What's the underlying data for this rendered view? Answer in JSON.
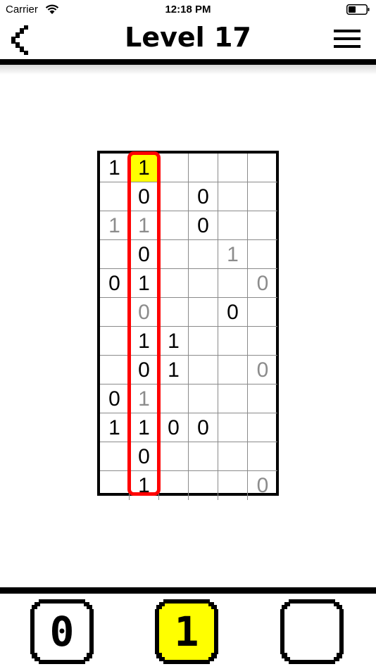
{
  "status_bar": {
    "carrier": "Carrier",
    "time": "12:18 PM"
  },
  "header": {
    "title": "Level 17",
    "back_icon": "back-chevron-icon",
    "menu_icon": "hamburger-menu-icon"
  },
  "colors": {
    "highlight_border": "#ff0000",
    "selected_cell": "#ffff00",
    "given_digit": "#000000",
    "entered_digit": "#8c8c8c",
    "active_key": "#ffff00"
  },
  "puzzle": {
    "rows": 12,
    "cols": 6,
    "highlighted_column": 2,
    "selected_cell": {
      "row": 1,
      "col": 2
    },
    "cells": [
      [
        {
          "v": "1",
          "s": "given"
        },
        {
          "v": "1",
          "s": "given"
        },
        {
          "v": "",
          "s": "empty"
        },
        {
          "v": "",
          "s": "empty"
        },
        {
          "v": "",
          "s": "empty"
        },
        {
          "v": "",
          "s": "empty"
        }
      ],
      [
        {
          "v": "",
          "s": "empty"
        },
        {
          "v": "0",
          "s": "given"
        },
        {
          "v": "",
          "s": "empty"
        },
        {
          "v": "0",
          "s": "given"
        },
        {
          "v": "",
          "s": "empty"
        },
        {
          "v": "",
          "s": "empty"
        }
      ],
      [
        {
          "v": "1",
          "s": "entered"
        },
        {
          "v": "1",
          "s": "entered"
        },
        {
          "v": "",
          "s": "empty"
        },
        {
          "v": "0",
          "s": "given"
        },
        {
          "v": "",
          "s": "empty"
        },
        {
          "v": "",
          "s": "empty"
        }
      ],
      [
        {
          "v": "",
          "s": "empty"
        },
        {
          "v": "0",
          "s": "given"
        },
        {
          "v": "",
          "s": "empty"
        },
        {
          "v": "",
          "s": "empty"
        },
        {
          "v": "1",
          "s": "entered"
        },
        {
          "v": "",
          "s": "empty"
        }
      ],
      [
        {
          "v": "0",
          "s": "given"
        },
        {
          "v": "1",
          "s": "given"
        },
        {
          "v": "",
          "s": "empty"
        },
        {
          "v": "",
          "s": "empty"
        },
        {
          "v": "",
          "s": "empty"
        },
        {
          "v": "0",
          "s": "entered"
        }
      ],
      [
        {
          "v": "",
          "s": "empty"
        },
        {
          "v": "0",
          "s": "entered"
        },
        {
          "v": "",
          "s": "empty"
        },
        {
          "v": "",
          "s": "empty"
        },
        {
          "v": "0",
          "s": "given"
        },
        {
          "v": "",
          "s": "empty"
        }
      ],
      [
        {
          "v": "",
          "s": "empty"
        },
        {
          "v": "1",
          "s": "given"
        },
        {
          "v": "1",
          "s": "given"
        },
        {
          "v": "",
          "s": "empty"
        },
        {
          "v": "",
          "s": "empty"
        },
        {
          "v": "",
          "s": "empty"
        }
      ],
      [
        {
          "v": "",
          "s": "empty"
        },
        {
          "v": "0",
          "s": "given"
        },
        {
          "v": "1",
          "s": "given"
        },
        {
          "v": "",
          "s": "empty"
        },
        {
          "v": "",
          "s": "empty"
        },
        {
          "v": "0",
          "s": "entered"
        }
      ],
      [
        {
          "v": "0",
          "s": "given"
        },
        {
          "v": "1",
          "s": "entered"
        },
        {
          "v": "",
          "s": "empty"
        },
        {
          "v": "",
          "s": "empty"
        },
        {
          "v": "",
          "s": "empty"
        },
        {
          "v": "",
          "s": "empty"
        }
      ],
      [
        {
          "v": "1",
          "s": "given"
        },
        {
          "v": "1",
          "s": "given"
        },
        {
          "v": "0",
          "s": "given"
        },
        {
          "v": "0",
          "s": "given"
        },
        {
          "v": "",
          "s": "empty"
        },
        {
          "v": "",
          "s": "empty"
        }
      ],
      [
        {
          "v": "",
          "s": "empty"
        },
        {
          "v": "0",
          "s": "given"
        },
        {
          "v": "",
          "s": "empty"
        },
        {
          "v": "",
          "s": "empty"
        },
        {
          "v": "",
          "s": "empty"
        },
        {
          "v": "",
          "s": "empty"
        }
      ],
      [
        {
          "v": "",
          "s": "empty"
        },
        {
          "v": "1",
          "s": "given"
        },
        {
          "v": "",
          "s": "empty"
        },
        {
          "v": "",
          "s": "empty"
        },
        {
          "v": "",
          "s": "empty"
        },
        {
          "v": "0",
          "s": "entered"
        }
      ]
    ]
  },
  "keypad": {
    "keys": [
      {
        "label": "0",
        "active": false
      },
      {
        "label": "1",
        "active": true
      },
      {
        "label": "",
        "active": false
      }
    ]
  }
}
